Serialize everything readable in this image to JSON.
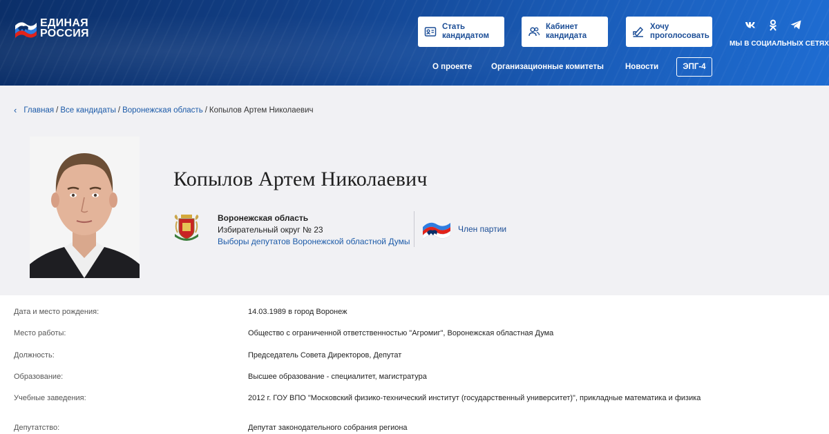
{
  "header": {
    "logo_line1": "ЕДИНАЯ",
    "logo_line2": "РОССИЯ",
    "buttons": {
      "candidate": "Стать\nкандидатом",
      "cabinet": "Кабинет\nкандидата",
      "vote": "Хочу\nпроголосовать"
    },
    "social_title": "МЫ В СОЦИАЛЬНЫХ СЕТЯХ",
    "social_icons": [
      "vk-icon",
      "odnoklassniki-icon",
      "telegram-icon"
    ],
    "nav": {
      "about": "О проекте",
      "committees": "Организационные комитеты",
      "news": "Новости",
      "epg": "ЭПГ-4"
    }
  },
  "breadcrumb": {
    "home": "Главная",
    "all": "Все кандидаты",
    "region": "Воронежская область",
    "current": "Копылов Артем Николаевич",
    "sep": "/"
  },
  "candidate": {
    "name": "Копылов Артем Николаевич",
    "region": "Воронежская область",
    "district": "Избирательный округ № 23",
    "elections": "Выборы депутатов Воронежской областной Думы",
    "status": "Член партии"
  },
  "details": [
    {
      "label": "Дата и место рождения:",
      "value": "14.03.1989 в город Воронеж"
    },
    {
      "label": "Место работы:",
      "value": "Общество с ограниченной ответственностью \"Агромиг\", Воронежская областная Дума"
    },
    {
      "label": "Должность:",
      "value": "Председатель Совета Директоров, Депутат"
    },
    {
      "label": "Образование:",
      "value": "Высшее образование - специалитет, магистратура"
    },
    {
      "label": "Учебные заведения:",
      "value": "2012 г. ГОУ ВПО \"Московский физико-технический институт (государственный университет)\", прикладные математика и физика"
    },
    {
      "label": "Депутатство:",
      "value": "Депутат законодательного собрания региона"
    }
  ],
  "colors": {
    "header_dark": "#0b2f69",
    "header_light": "#1e6cd1",
    "link": "#1b5aa8",
    "panel": "#f1f1f4"
  }
}
